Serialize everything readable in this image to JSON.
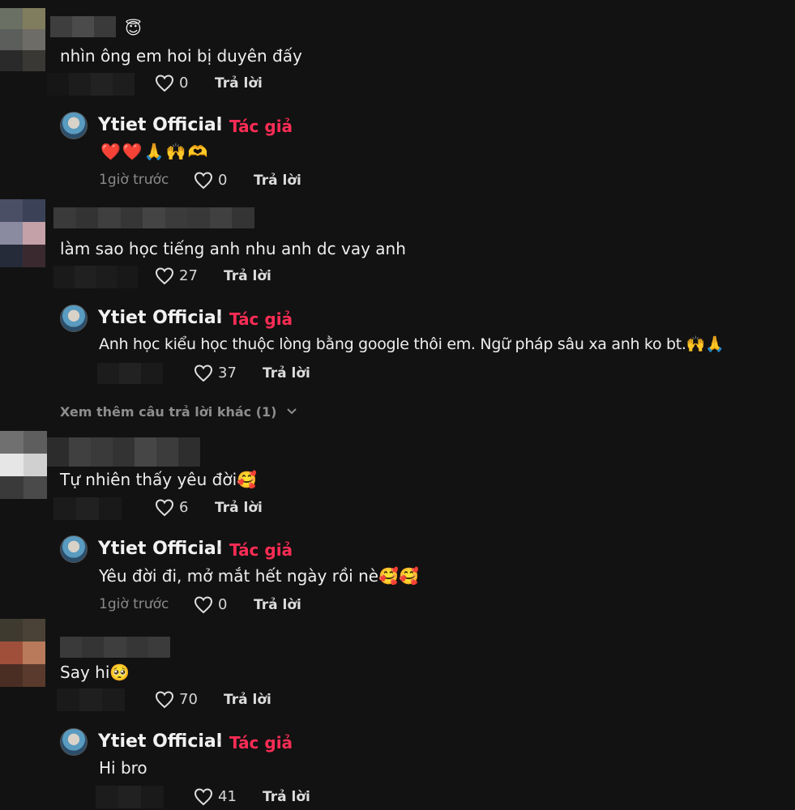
{
  "comments": [
    {
      "text": "nhìn ông em hoi bị duyên đấy",
      "likes": "0",
      "reply_label": "Trả lời",
      "name_emoji": "😇",
      "reply": {
        "author": "Ytiet Official",
        "author_badge": "Tác giả",
        "separator": "·",
        "text": "❤️❤️🙏🙌🫶",
        "time": "1giờ trước",
        "likes": "0",
        "reply_label": "Trả lời"
      }
    },
    {
      "text": "làm sao học tiếng anh nhu anh dc vay anh",
      "likes": "27",
      "reply_label": "Trả lời",
      "reply": {
        "author": "Ytiet Official",
        "author_badge": "Tác giả",
        "separator": "·",
        "text": "Anh học kiểu học thuộc lòng bằng google thôi em. Ngữ pháp sâu xa anh ko bt.🙌🙏",
        "likes": "37",
        "reply_label": "Trả lời"
      },
      "more_replies": "Xem thêm câu trả lời khác (1)"
    },
    {
      "text": "Tự nhiên thấy yêu đời🥰",
      "likes": "6",
      "reply_label": "Trả lời",
      "reply": {
        "author": "Ytiet Official",
        "author_badge": "Tác giả",
        "separator": "·",
        "text": "Yêu đời đi, mở mắt hết ngày rồi nè🥰🥰",
        "time": "1giờ trước",
        "likes": "0",
        "reply_label": "Trả lời"
      }
    },
    {
      "text": "Say hi🥺",
      "likes": "70",
      "reply_label": "Trả lời",
      "reply": {
        "author": "Ytiet Official",
        "author_badge": "Tác giả",
        "separator": "·",
        "text": "Hi bro",
        "likes": "41",
        "reply_label": "Trả lời"
      }
    }
  ],
  "colors": {
    "background": "#121212",
    "author_badge": "#fe2c55",
    "muted": "#8a8a8a"
  },
  "icons": {
    "like": "heart-outline-icon",
    "expand": "chevron-down-icon"
  }
}
